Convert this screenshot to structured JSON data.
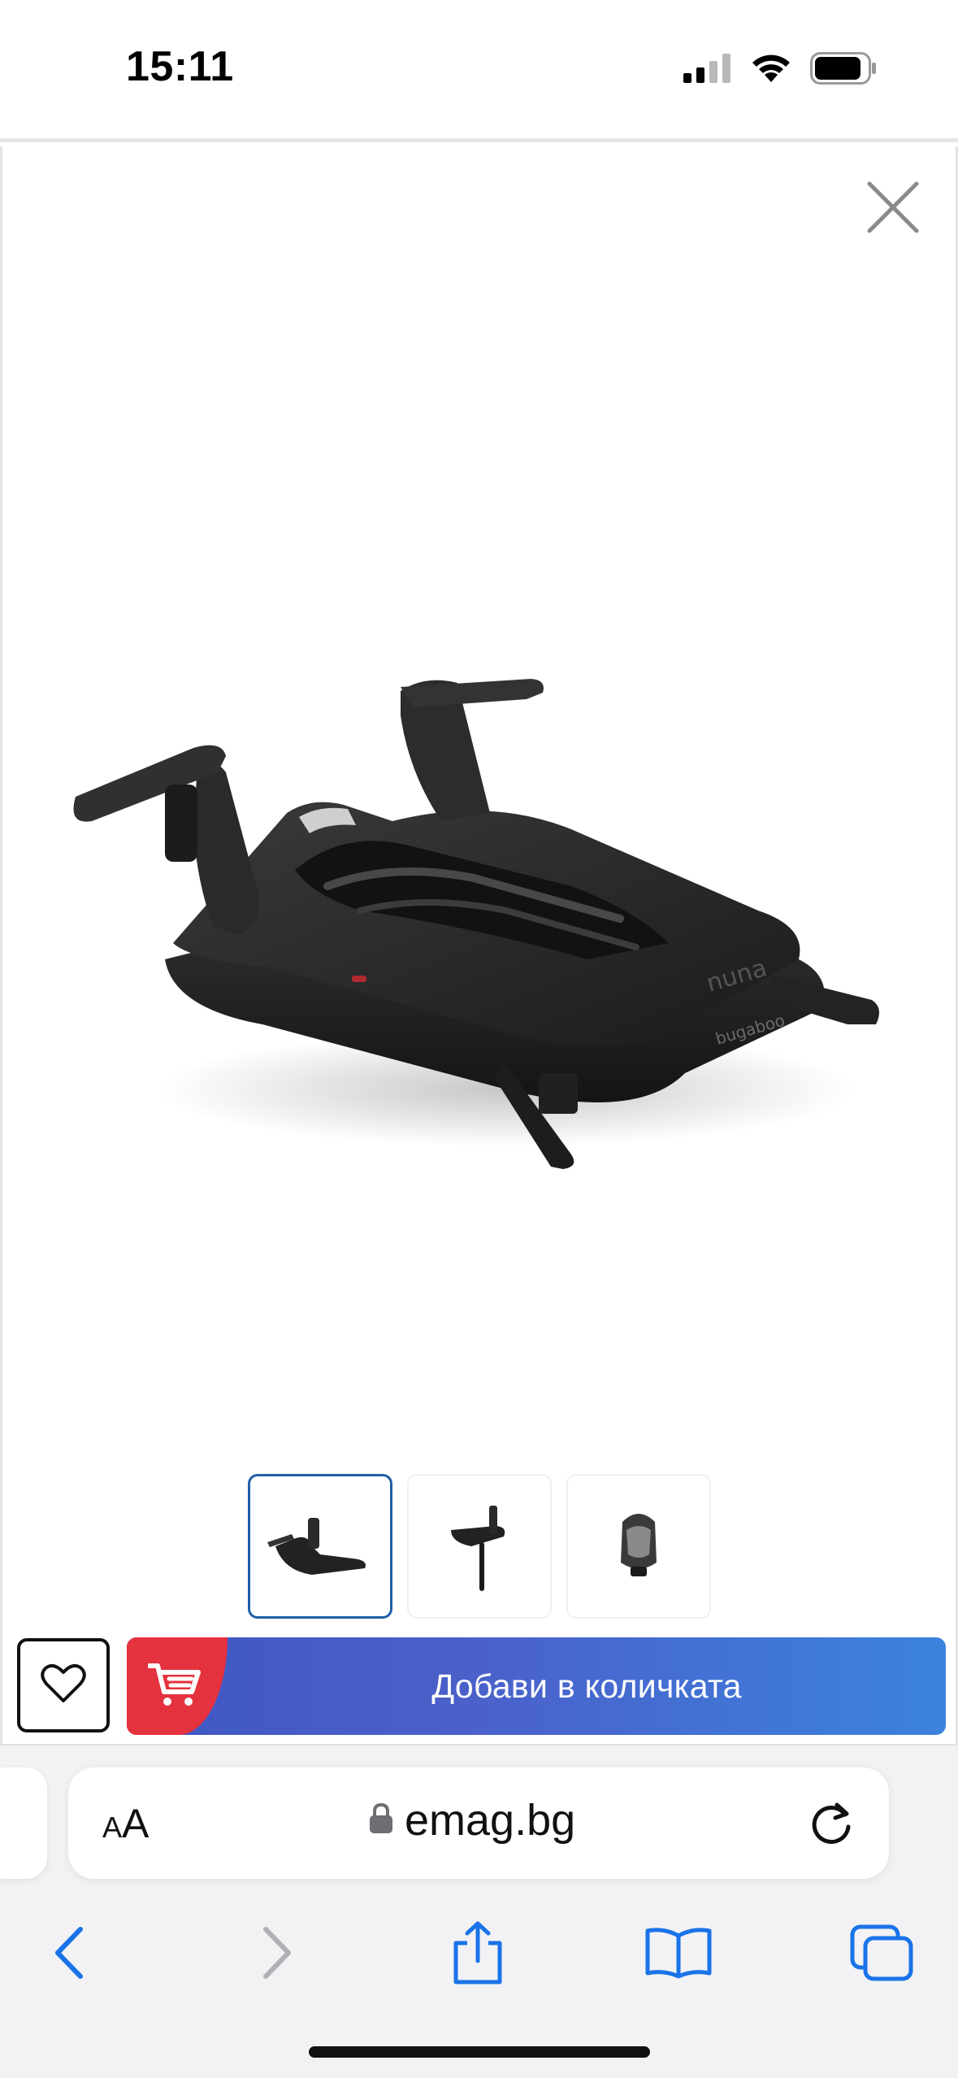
{
  "status_bar": {
    "time": "15:11"
  },
  "gallery": {
    "close_icon": "close-icon",
    "product_image_alt": "",
    "thumbnails": [
      {
        "id": "thumb-1",
        "active": true
      },
      {
        "id": "thumb-2",
        "active": false
      },
      {
        "id": "thumb-3",
        "active": false
      }
    ]
  },
  "actions": {
    "favorite_icon": "heart-icon",
    "cart_icon": "cart-icon",
    "add_to_cart_label": "Добави в количката"
  },
  "browser": {
    "aa_label_small": "A",
    "aa_label_large": "A",
    "url": "emag.bg"
  },
  "colors": {
    "cart_red": "#e5323f",
    "cart_gradient_start": "#3e57c4",
    "cart_gradient_end": "#3b82de",
    "ios_blue": "#1a73e8",
    "active_thumb_border": "#1e5fa8"
  }
}
